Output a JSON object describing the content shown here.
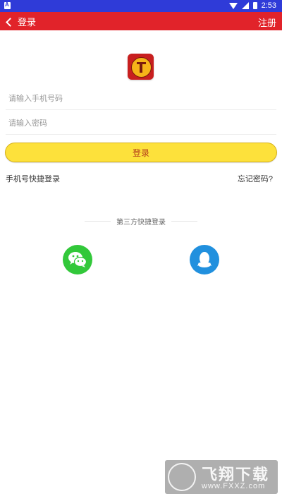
{
  "status_bar": {
    "time": "2:53",
    "icons": [
      "notification-icon",
      "wifi-icon",
      "signal-icon",
      "battery-icon"
    ]
  },
  "app_bar": {
    "title": "登录",
    "action": "注册",
    "background": "#e1232a",
    "back_icon": "chevron-left-icon"
  },
  "form": {
    "phone_placeholder": "请输入手机号码",
    "password_placeholder": "请输入密码",
    "phone_value": "",
    "password_value": "",
    "login_button": "登录",
    "button_color": "#fde13b"
  },
  "links": {
    "quick_login": "手机号快捷登录",
    "forgot_password": "忘记密码?"
  },
  "third_party": {
    "label": "第三方快捷登录",
    "providers": [
      {
        "name": "wechat",
        "icon": "wechat-icon",
        "color": "#32c83a"
      },
      {
        "name": "qq",
        "icon": "qq-icon",
        "color": "#2190de"
      }
    ]
  },
  "watermark": {
    "title": "飞翔下载",
    "url": "www.FXXZ.com"
  }
}
